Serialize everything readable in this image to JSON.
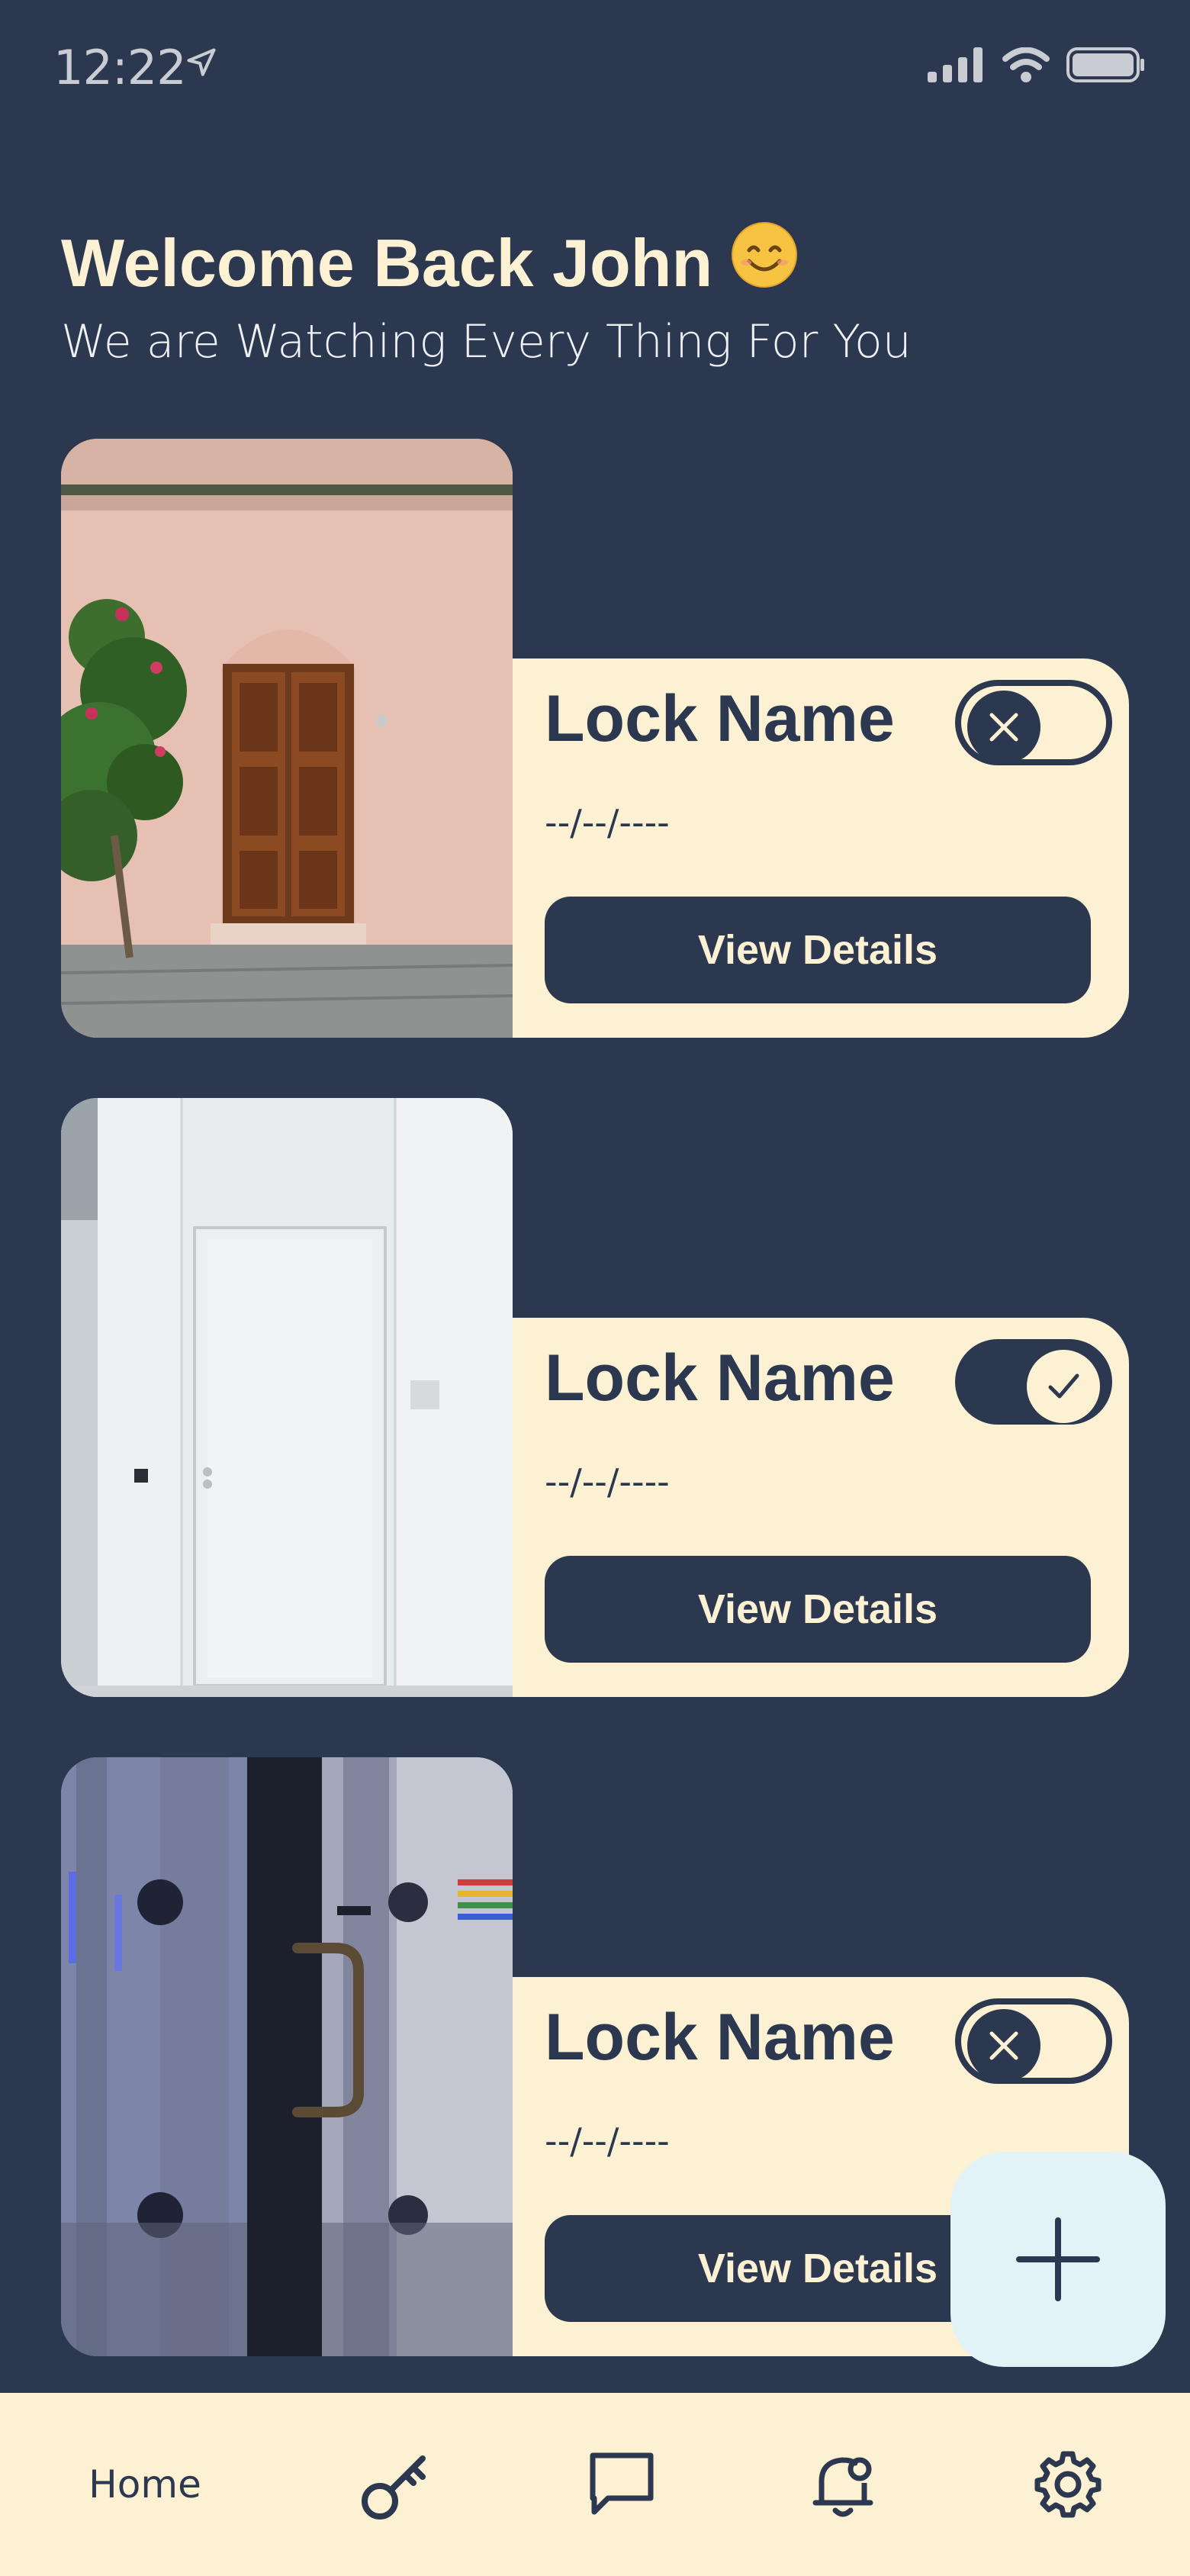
{
  "status_bar": {
    "time": "12:22"
  },
  "header": {
    "title": "Welcome Back John",
    "emoji": "😊",
    "subtitle": "We are Watching Every Thing For You"
  },
  "locks": [
    {
      "name": "Lock Name",
      "date": "--/--/----",
      "button_label": "View Details",
      "toggle_on": false,
      "photo": "old-wooden-door"
    },
    {
      "name": "Lock Name",
      "date": "--/--/----",
      "button_label": "View Details",
      "toggle_on": true,
      "photo": "white-office-door"
    },
    {
      "name": "Lock Name",
      "date": "--/--/----",
      "button_label": "View Details",
      "toggle_on": false,
      "photo": "glass-door-handle"
    }
  ],
  "fab": {
    "icon": "plus-icon"
  },
  "bottom_nav": {
    "home_label": "Home",
    "icons": [
      "key-icon",
      "chat-icon",
      "bell-icon",
      "settings-icon"
    ]
  },
  "colors": {
    "background": "#2c3850",
    "card": "#fdf1d4",
    "fab": "#e2f3f8",
    "nav": "#fdf1d4"
  }
}
